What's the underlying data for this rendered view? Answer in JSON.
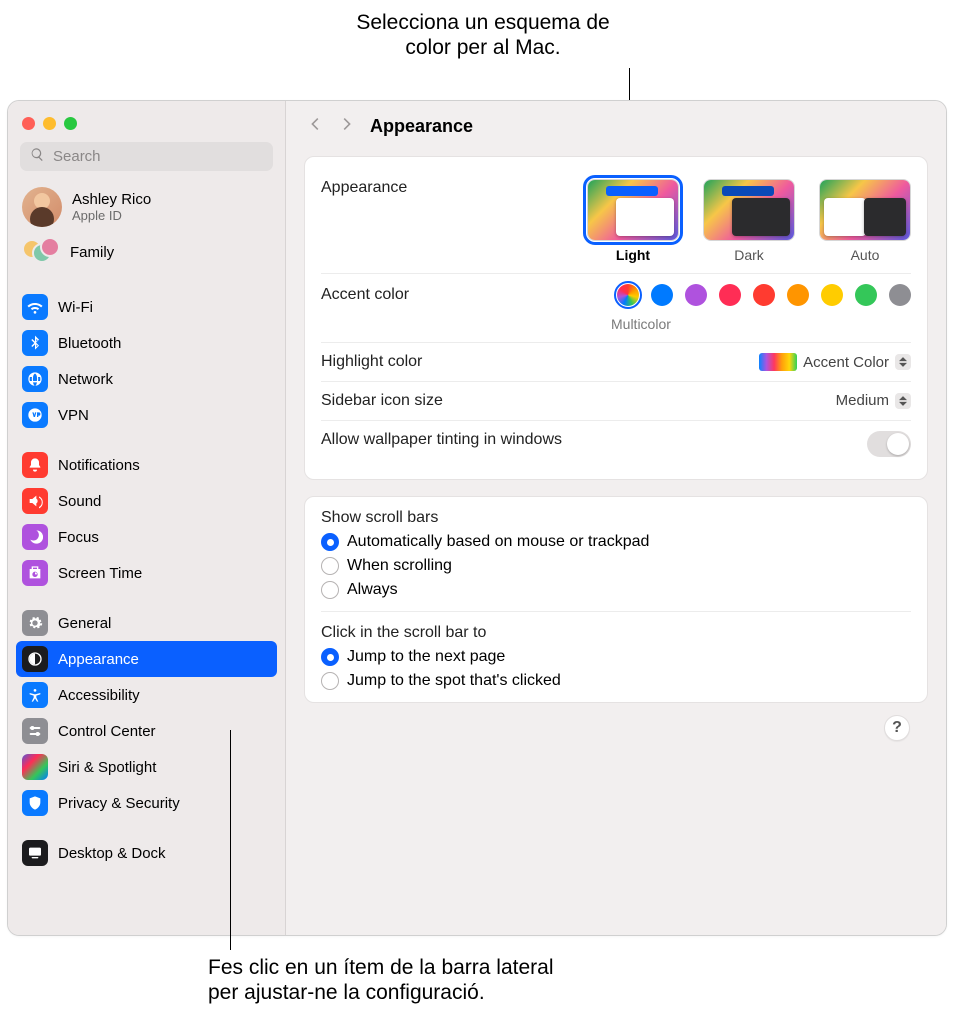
{
  "callouts": {
    "top": "Selecciona un esquema de color per al Mac.",
    "bottom_l1": "Fes clic en un ítem de la barra lateral",
    "bottom_l2": "per ajustar-ne la configuració."
  },
  "search": {
    "placeholder": "Search"
  },
  "account": {
    "name": "Ashley Rico",
    "sub": "Apple ID"
  },
  "family": {
    "label": "Family"
  },
  "sidebar": {
    "group1": [
      {
        "label": "Wi-Fi"
      },
      {
        "label": "Bluetooth"
      },
      {
        "label": "Network"
      },
      {
        "label": "VPN"
      }
    ],
    "group2": [
      {
        "label": "Notifications"
      },
      {
        "label": "Sound"
      },
      {
        "label": "Focus"
      },
      {
        "label": "Screen Time"
      }
    ],
    "group3": [
      {
        "label": "General"
      },
      {
        "label": "Appearance"
      },
      {
        "label": "Accessibility"
      },
      {
        "label": "Control Center"
      },
      {
        "label": "Siri & Spotlight"
      },
      {
        "label": "Privacy & Security"
      }
    ],
    "group4": [
      {
        "label": "Desktop & Dock"
      }
    ]
  },
  "toolbar": {
    "title": "Appearance"
  },
  "appearance": {
    "label": "Appearance",
    "light": "Light",
    "dark": "Dark",
    "auto": "Auto"
  },
  "accent": {
    "label": "Accent color",
    "sub": "Multicolor",
    "colors": [
      "multicolor",
      "#007aff",
      "#af52de",
      "#ff2d55",
      "#ff3b30",
      "#ff9500",
      "#ffcc00",
      "#34c759",
      "#8e8e93"
    ]
  },
  "highlight": {
    "label": "Highlight color",
    "value": "Accent Color"
  },
  "sidebariconsize": {
    "label": "Sidebar icon size",
    "value": "Medium"
  },
  "wallpapertint": {
    "label": "Allow wallpaper tinting in windows"
  },
  "scrollbars": {
    "heading": "Show scroll bars",
    "opt1": "Automatically based on mouse or trackpad",
    "opt2": "When scrolling",
    "opt3": "Always"
  },
  "scrollclick": {
    "heading": "Click in the scroll bar to",
    "opt1": "Jump to the next page",
    "opt2": "Jump to the spot that's clicked"
  },
  "help": "?"
}
